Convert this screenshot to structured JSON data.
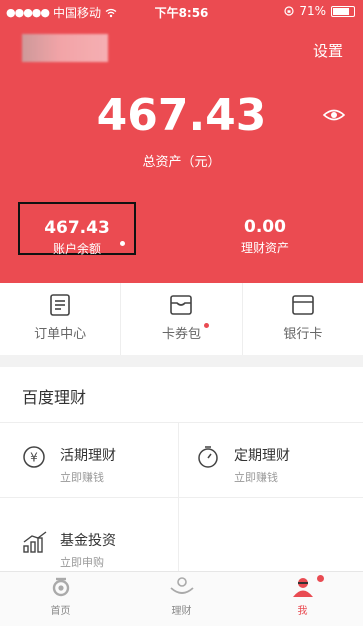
{
  "colors": {
    "accent": "#EB4B51",
    "hero_bg": "#EB4B51"
  },
  "status_bar": {
    "carrier": "中国移动",
    "time": "下午8:56",
    "battery": "71%",
    "battery_level": 0.71
  },
  "header": {
    "settings": "设置"
  },
  "assets": {
    "total": "467.43",
    "total_label": "总资产（元）"
  },
  "stats": [
    {
      "value": "467.43",
      "label": "账户余额"
    },
    {
      "value": "0.00",
      "label": "理财资产"
    }
  ],
  "quick_actions": [
    {
      "label": "订单中心",
      "icon": "order-list-icon"
    },
    {
      "label": "卡券包",
      "icon": "coupon-wallet-icon"
    },
    {
      "label": "银行卡",
      "icon": "bank-card-icon"
    }
  ],
  "section": {
    "title": "百度理财"
  },
  "products": [
    {
      "name": "活期理财",
      "sub": "立即赚钱",
      "icon": "yen-circle-icon"
    },
    {
      "name": "定期理财",
      "sub": "立即赚钱",
      "icon": "timer-icon"
    },
    {
      "name": "基金投资",
      "sub": "立即申购",
      "icon": "growth-chart-icon"
    }
  ],
  "tabs": [
    {
      "label": "首页",
      "icon": "home-logo-icon"
    },
    {
      "label": "理财",
      "icon": "finance-hand-icon"
    },
    {
      "label": "我",
      "icon": "profile-icon"
    }
  ]
}
